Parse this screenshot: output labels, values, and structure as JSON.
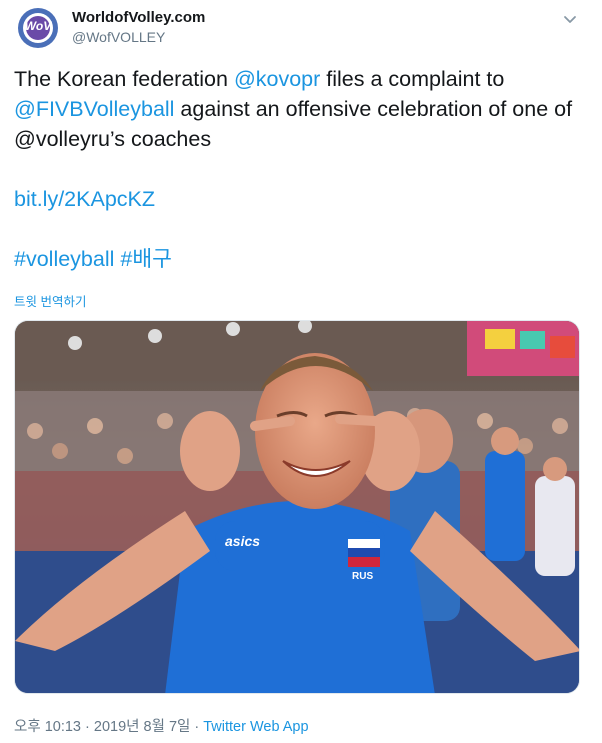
{
  "account": {
    "name": "WorldofVolley.com",
    "handle": "@WofVOLLEY",
    "avatar_text": "WoV"
  },
  "tweet": {
    "part1": "The Korean federation ",
    "mention1": "@kovopr",
    "part2": " files a complaint to ",
    "mention2": "@FIVBVolleyball",
    "part3": " against an offensive celebration of one of @volleyru’s coaches",
    "url": "bit.ly/2KApcKZ",
    "hashtag1": "#volleyball",
    "hashtag2": "#배구"
  },
  "translate_label": "트윗 번역하기",
  "meta": {
    "time": "오후 10:13",
    "sep1": " · ",
    "date": "2019년 8월 7일",
    "sep2": " · ",
    "source": "Twitter Web App"
  },
  "media": {
    "shirt_logo": "asics",
    "badge_text": "RUS"
  },
  "icons": {
    "menu": "chevron-down-icon"
  },
  "colors": {
    "link": "#1b95e0",
    "secondary": "#657786",
    "shirt": "#1f6fd6"
  }
}
